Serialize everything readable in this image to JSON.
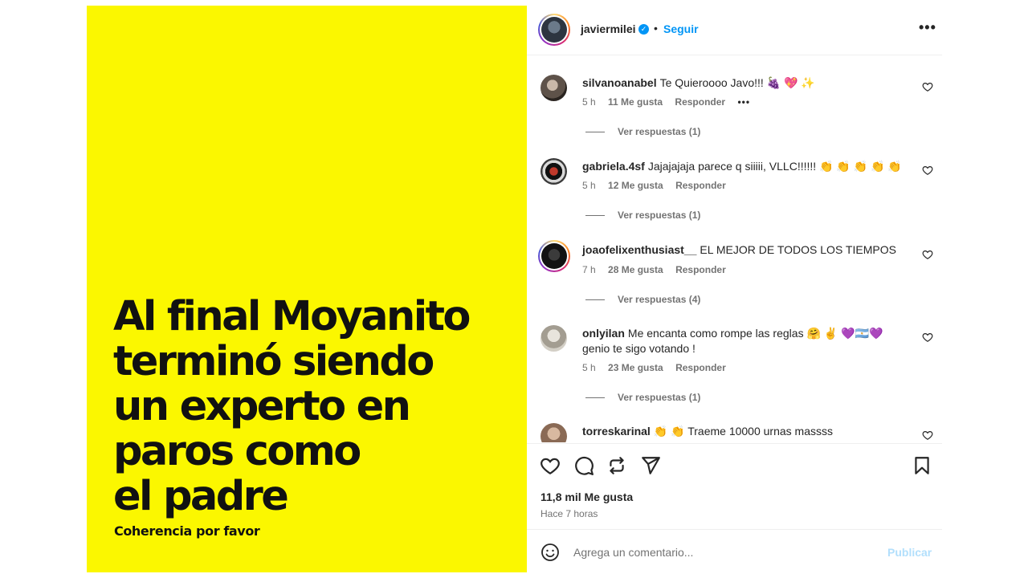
{
  "post": {
    "headline_lines": [
      "Al final Moyanito",
      "terminó siendo",
      "un experto en",
      "paros como",
      "el padre"
    ],
    "subline": "Coherencia por favor",
    "background_color": "#fbf700"
  },
  "header": {
    "username": "javiermilei",
    "separator": "•",
    "follow_label": "Seguir",
    "more_label": "•••"
  },
  "comments": [
    {
      "user": "silvanoanabel",
      "text": "Te Quieroooo Javo!!! 🍇 💖 ✨",
      "time": "5 h",
      "likes": "11 Me gusta",
      "reply": "Responder",
      "more": "•••",
      "replies": "Ver respuestas (1)"
    },
    {
      "user": "gabriela.4sf",
      "text": "Jajajajaja parece q siiiii, VLLC!!!!!! 👏 👏 👏 👏 👏",
      "time": "5 h",
      "likes": "12 Me gusta",
      "reply": "Responder",
      "replies": "Ver respuestas (1)"
    },
    {
      "user": "joaofelixenthusiast__",
      "text": "EL MEJOR DE TODOS LOS TIEMPOS",
      "time": "7 h",
      "likes": "28 Me gusta",
      "reply": "Responder",
      "replies": "Ver respuestas (4)"
    },
    {
      "user": "onlyilan",
      "text": "Me encanta como rompe las reglas 🤗 ✌️ 💜🇦🇷💜 genio te sigo votando !",
      "time": "5 h",
      "likes": "23 Me gusta",
      "reply": "Responder",
      "replies": "Ver respuestas (1)"
    },
    {
      "user": "torreskarinal",
      "text": "👏 👏 Traeme 10000 urnas massss"
    }
  ],
  "footer": {
    "likes": "11,8 mil Me gusta",
    "time_ago": "Hace 7 horas",
    "comment_placeholder": "Agrega un comentario...",
    "publish_label": "Publicar"
  },
  "colors": {
    "accent": "#0095f6",
    "publish_disabled": "#b2dffc",
    "muted": "#737373"
  }
}
